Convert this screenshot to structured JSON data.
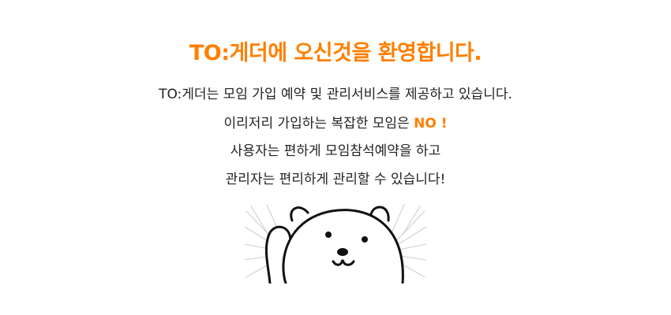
{
  "welcome": {
    "title": "TO:게더에 오신것을 환영합니다.",
    "line1": "TO:게더는 모임 가입 예약 및 관리서비스를 제공하고 있습니다.",
    "line2_text": "이리저리 가입하는 복잡한 모임은 ",
    "line2_accent": "NO !",
    "line3": "사용자는 편하게 모임참석예약을 하고",
    "line4": "관리자는 편리하게 관리할 수 있습니다!",
    "accent_color": "#ff7f00",
    "illustration_icon": "bear-waving-icon"
  }
}
